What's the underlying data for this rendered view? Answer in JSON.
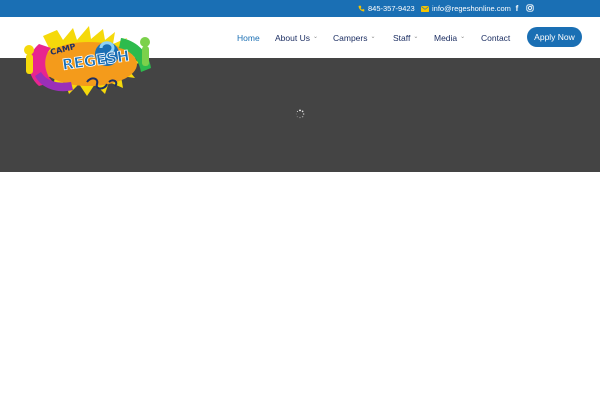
{
  "topbar": {
    "phone": "845-357-9423",
    "email": "info@regeshonline.com",
    "background": "#1a6fb4",
    "icons": [
      "phone-icon",
      "email-icon",
      "facebook-icon",
      "instagram-icon"
    ]
  },
  "logo": {
    "text_top": "CAMP",
    "text_main": "REGESH",
    "alt": "Camp Regesh logo"
  },
  "nav": {
    "items": [
      {
        "label": "Home",
        "active": true,
        "has_dropdown": false
      },
      {
        "label": "About Us",
        "active": false,
        "has_dropdown": true
      },
      {
        "label": "Campers",
        "active": false,
        "has_dropdown": true
      },
      {
        "label": "Staff",
        "active": false,
        "has_dropdown": true
      },
      {
        "label": "Media",
        "active": false,
        "has_dropdown": true
      },
      {
        "label": "Contact",
        "active": false,
        "has_dropdown": false
      }
    ],
    "cta": "Apply Now",
    "dropdown_glyph": "⌄"
  },
  "hero": {
    "background": "#444444",
    "state": "loading"
  },
  "colors": {
    "brand_blue": "#1a6fb4",
    "nav_text": "#1d2f63"
  }
}
